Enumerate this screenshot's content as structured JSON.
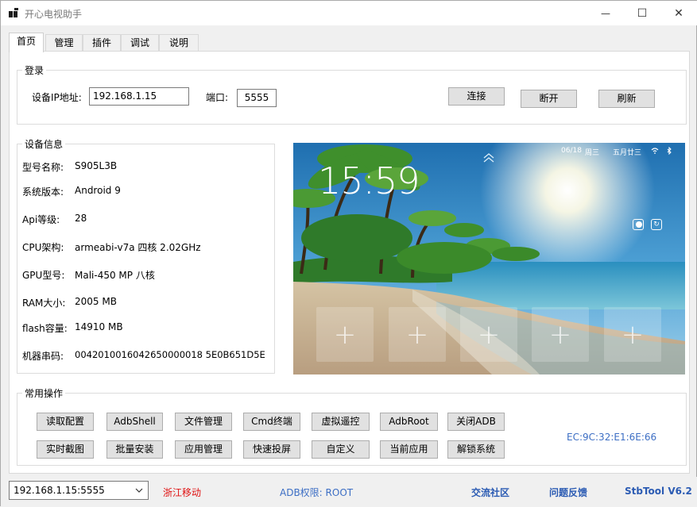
{
  "window": {
    "title": "开心电视助手",
    "minimize_glyph": "—",
    "maximize_glyph": "☐",
    "close_glyph": "✕"
  },
  "tabs": [
    "首页",
    "管理",
    "插件",
    "调试",
    "说明"
  ],
  "login": {
    "group_label": "登录",
    "ip_label": "设备IP地址:",
    "ip_value": "192.168.1.15",
    "port_label": "端口:",
    "port_value": "5555",
    "connect_button": "连接",
    "disconnect_button": "断开",
    "refresh_button": "刷新"
  },
  "device_info": {
    "group_label": "设备信息",
    "rows": [
      {
        "label": "型号名称:",
        "value": "S905L3B"
      },
      {
        "label": "系统版本:",
        "value": "Android 9"
      },
      {
        "label": "Api等级:",
        "value": "28"
      },
      {
        "label": "CPU架构:",
        "value": "armeabi-v7a 四核 2.02GHz"
      },
      {
        "label": "GPU型号:",
        "value": "Mali-450 MP 八核"
      },
      {
        "label": "RAM大小:",
        "value": "2005 MB"
      },
      {
        "label": "flash容量:",
        "value": "14910 MB"
      },
      {
        "label": "机器串码:",
        "value": "0042010016042650000018 5E0B651D5E"
      }
    ]
  },
  "tv_screen": {
    "date": "06/18",
    "weekday": "周三",
    "lunar_date": "五月廿三",
    "clock": "15:59",
    "tile_glyph": "+",
    "tile_count": 5
  },
  "ops": {
    "group_label": "常用操作",
    "row1": [
      "读取配置",
      "AdbShell",
      "文件管理",
      "Cmd终端",
      "虚拟遥控",
      "AdbRoot",
      "关闭ADB"
    ],
    "row2": [
      "实时截图",
      "批量安装",
      "应用管理",
      "快速投屏",
      "自定义",
      "当前应用",
      "解锁系统"
    ],
    "mac": "EC:9C:32:E1:6E:66"
  },
  "status": {
    "device_select": "192.168.1.15:5555",
    "carrier": "浙江移动",
    "adb_permission": "ADB权限: ROOT",
    "community_link": "交流社区",
    "feedback_link": "问题反馈",
    "version": "StbTool V6.2"
  },
  "colors": {
    "carrier_red": "#e01010",
    "info_blue": "#3c6ec4",
    "link_blue": "#2b5bb3"
  }
}
